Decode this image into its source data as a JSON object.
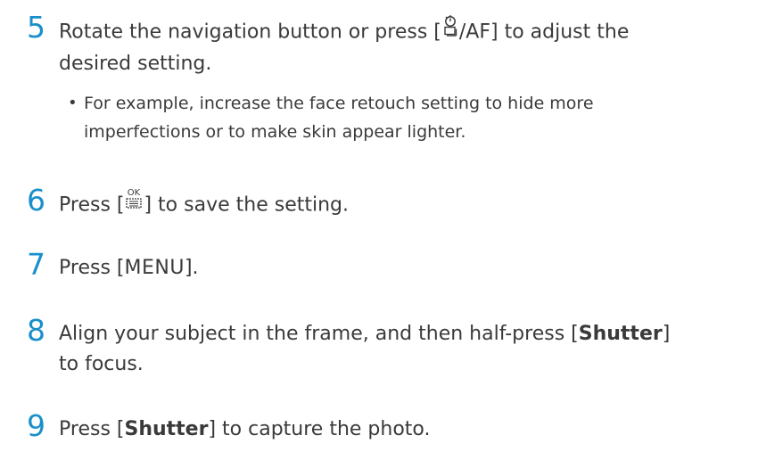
{
  "steps": [
    {
      "number": "5",
      "text_pre": "Rotate the navigation button or press [",
      "key_label": "AF",
      "text_post_line1": "] to adjust the",
      "text_line2": "desired setting."
    },
    {
      "number": "6",
      "text_pre": "Press [",
      "text_post": "] to save the setting."
    },
    {
      "number": "7",
      "text_pre": "Press [",
      "menu_label": "MENU",
      "text_post": "]."
    },
    {
      "number": "8",
      "text_line1_pre": "Align your subject in the frame, and then half-press [",
      "shutter_label": "Shutter",
      "text_line1_post": "]",
      "text_line2": "to focus."
    },
    {
      "number": "9",
      "text_pre": "Press [",
      "shutter_label": "Shutter",
      "text_post": "] to capture the photo."
    }
  ],
  "bullet": {
    "symbol": "•",
    "line1": "For example, increase the face retouch setting to hide more",
    "line2": "imperfections or to make skin appear lighter."
  },
  "colors": {
    "step_number": "#1a8fc9",
    "body_text": "#3a3a3a"
  },
  "icons": {
    "self_timer_drive": "self-timer-drive-icon",
    "ok_menu": "ok-menu-icon"
  }
}
